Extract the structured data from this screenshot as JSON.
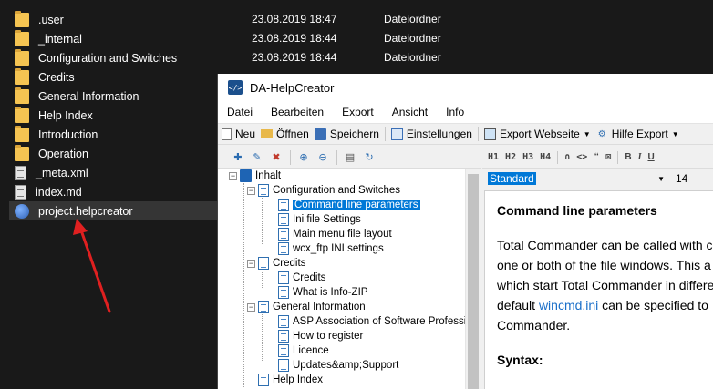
{
  "explorer": {
    "rows": [
      {
        "name": ".user",
        "date": "23.08.2019 18:47",
        "type": "Dateiordner",
        "icon": "folder-icon"
      },
      {
        "name": "_internal",
        "date": "23.08.2019 18:44",
        "type": "Dateiordner",
        "icon": "folder-icon"
      },
      {
        "name": "Configuration and Switches",
        "date": "23.08.2019 18:44",
        "type": "Dateiordner",
        "icon": "folder-icon"
      },
      {
        "name": "Credits",
        "date": "",
        "type": "",
        "icon": "folder-icon"
      },
      {
        "name": "General Information",
        "date": "",
        "type": "",
        "icon": "folder-icon"
      },
      {
        "name": "Help Index",
        "date": "",
        "type": "",
        "icon": "folder-icon"
      },
      {
        "name": "Introduction",
        "date": "",
        "type": "",
        "icon": "folder-icon"
      },
      {
        "name": "Operation",
        "date": "",
        "type": "",
        "icon": "folder-icon"
      },
      {
        "name": "_meta.xml",
        "date": "",
        "type": "",
        "icon": "xml-file-icon"
      },
      {
        "name": "index.md",
        "date": "",
        "type": "",
        "icon": "md-file-icon"
      },
      {
        "name": "project.helpcreator",
        "date": "",
        "type": "",
        "icon": "helpcreator-file-icon"
      }
    ]
  },
  "app": {
    "title": "DA-HelpCreator",
    "menu": [
      "Datei",
      "Bearbeiten",
      "Export",
      "Ansicht",
      "Info"
    ],
    "toolbar": {
      "new_label": "Neu",
      "open_label": "Öffnen",
      "save_label": "Speichern",
      "settings_label": "Einstellungen",
      "export_web_label": "Export Webseite",
      "help_export_label": "Hilfe Export"
    },
    "format_bar": [
      "H1",
      "H2",
      "H3",
      "H4"
    ],
    "style": {
      "value": "Standard",
      "size": "14"
    },
    "tree": {
      "root": "Inhalt",
      "config": "Configuration and Switches",
      "config_children": [
        "Command line parameters",
        "Ini file Settings",
        "Main menu file layout",
        "wcx_ftp INI settings"
      ],
      "credits": "Credits",
      "credits_children": [
        "Credits",
        "What is Info-ZIP"
      ],
      "general": "General Information",
      "general_children": [
        "ASP Association of Software Profession",
        "How to register",
        "Licence",
        "Updates&amp;Support"
      ],
      "help_index": "Help Index"
    },
    "content": {
      "heading": "Command line parameters",
      "para_line1": "Total Commander can be called with c",
      "para_line2": "one or both of the file windows. This a",
      "para_line3": "which start Total Commander in differe",
      "para_line4_pre": "default ",
      "para_line4_link": "wincmd.ini",
      "para_line4_post": " can be specified to",
      "para_line5": "Commander.",
      "syntax": "Syntax:"
    }
  },
  "colors": {
    "selection": "#0078d7",
    "link": "#1a6fc9",
    "folder": "#f5c452",
    "arrow": "#e02020"
  }
}
